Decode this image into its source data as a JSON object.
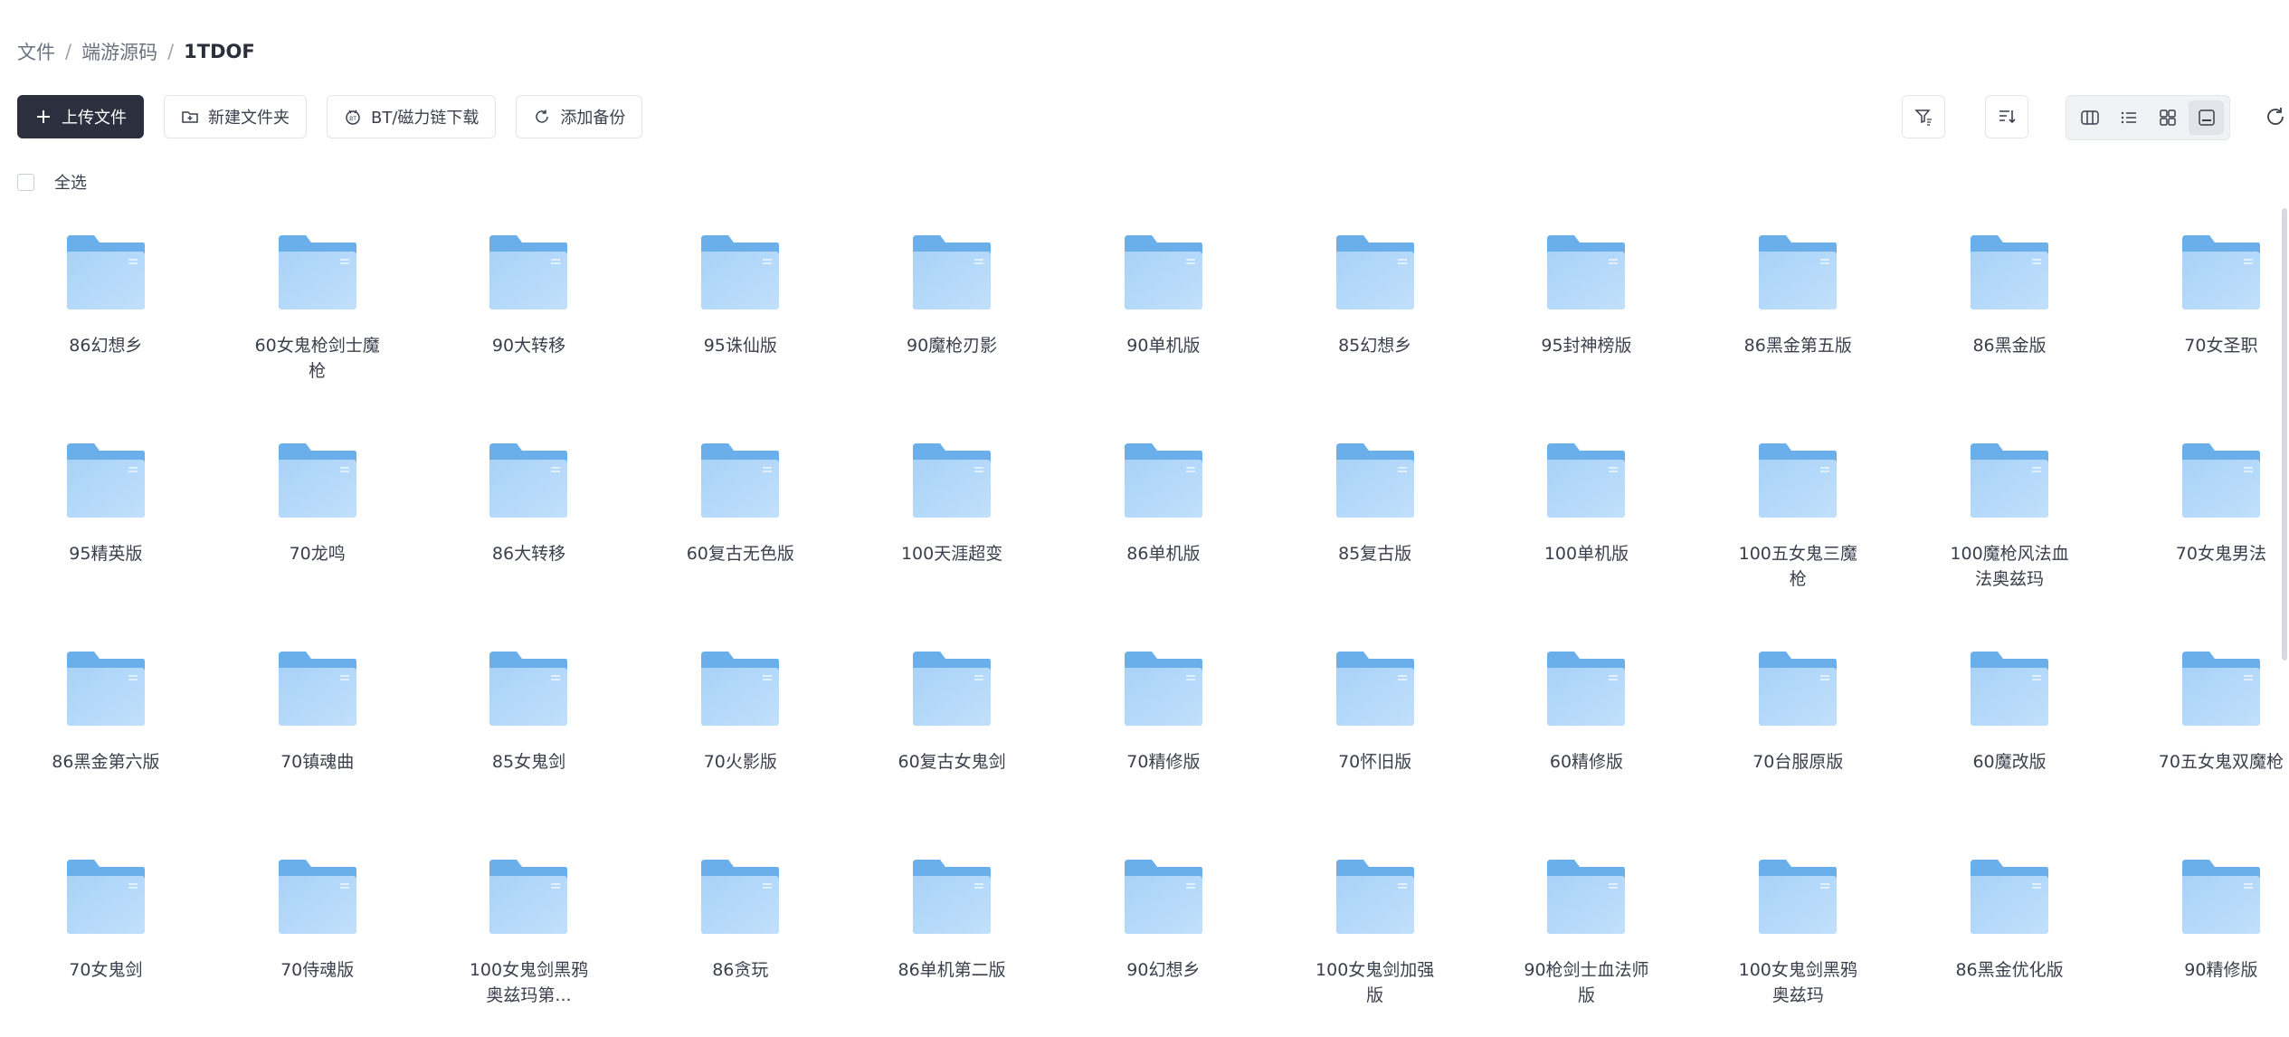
{
  "breadcrumb": {
    "items": [
      "文件",
      "端游源码",
      "1TDOF"
    ]
  },
  "toolbar": {
    "upload_label": "上传文件",
    "new_folder_label": "新建文件夹",
    "bt_download_label": "BT/磁力链下载",
    "add_backup_label": "添加备份"
  },
  "select_all_label": "全选",
  "folders": [
    "86幻想乡",
    "60女鬼枪剑士魔枪",
    "90大转移",
    "95诛仙版",
    "90魔枪刃影",
    "90单机版",
    "85幻想乡",
    "95封神榜版",
    "86黑金第五版",
    "86黑金版",
    "70女圣职",
    "95精英版",
    "70龙鸣",
    "86大转移",
    "60复古无色版",
    "100天涯超变",
    "86单机版",
    "85复古版",
    "100单机版",
    "100五女鬼三魔枪",
    "100魔枪风法血法奥兹玛",
    "70女鬼男法",
    "86黑金第六版",
    "70镇魂曲",
    "85女鬼剑",
    "70火影版",
    "60复古女鬼剑",
    "70精修版",
    "70怀旧版",
    "60精修版",
    "70台服原版",
    "60魔改版",
    "70五女鬼双魔枪",
    "70女鬼剑",
    "70侍魂版",
    "100女鬼剑黑鸦奥兹玛第...",
    "86贪玩",
    "86单机第二版",
    "90幻想乡",
    "100女鬼剑加强版",
    "90枪剑士血法师版",
    "100女鬼剑黑鸦奥兹玛",
    "86黑金优化版",
    "90精修版"
  ],
  "colors": {
    "primary_button": "#2b2f3e",
    "folder_back": "#6aaeea",
    "folder_front": "#a9d2f8"
  }
}
